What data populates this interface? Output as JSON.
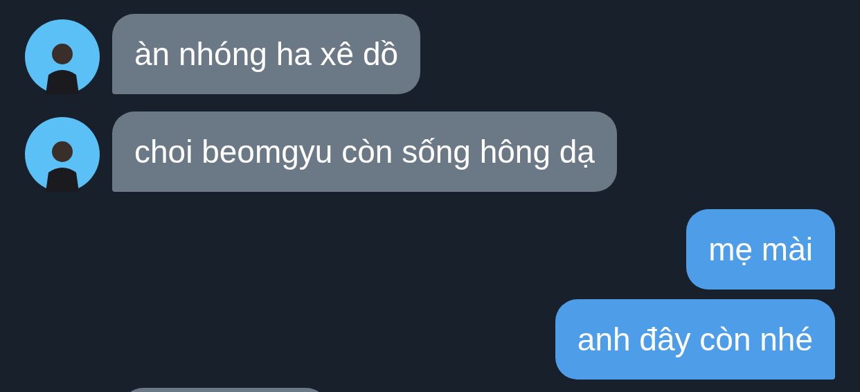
{
  "messages": [
    {
      "kind": "received",
      "avatar": true,
      "text": "àn nhóng ha xê dồ"
    },
    {
      "kind": "received",
      "avatar": true,
      "text": "choi beomgyu còn sống hông dạ"
    },
    {
      "kind": "sent",
      "avatar": false,
      "text": "mẹ mài"
    },
    {
      "kind": "sent",
      "avatar": false,
      "text": "anh đây còn nhé"
    },
    {
      "kind": "received",
      "avatar": false
    }
  ]
}
